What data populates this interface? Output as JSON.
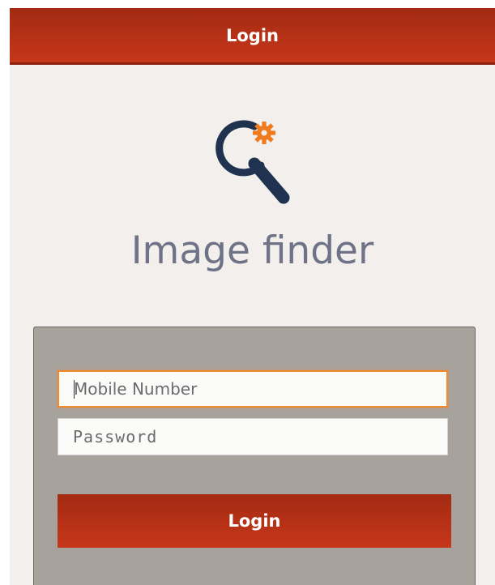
{
  "header": {
    "title": "Login"
  },
  "logo": {
    "icon": "magnifier-gear-icon",
    "colors": {
      "lens": "#1f3350",
      "gear": "#f07a1e"
    }
  },
  "app_name": "Image finder",
  "form": {
    "mobile": {
      "placeholder": "Mobile Number",
      "value": ""
    },
    "password": {
      "placeholder": "Password",
      "value": ""
    },
    "submit_label": "Login"
  },
  "colors": {
    "brand": "#b8321a",
    "background": "#f3efec",
    "panel": "#a8a29d",
    "focus": "#f08a2a"
  }
}
